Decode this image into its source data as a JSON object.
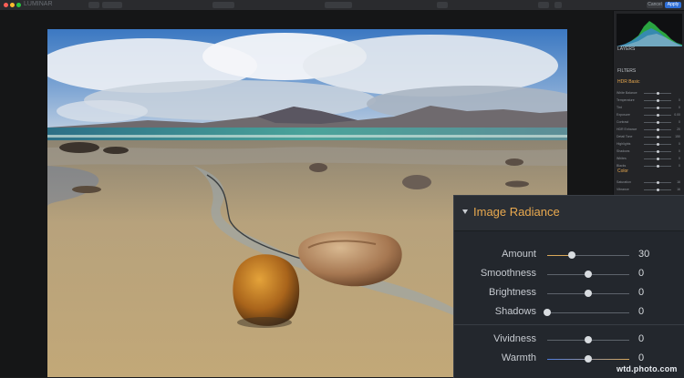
{
  "app": {
    "name": "LUMINAR",
    "cancel_label": "Cancel",
    "apply_label": "Apply"
  },
  "sidebar": {
    "layers_label": "LAYERS",
    "filters_label": "FILTERS",
    "section_hdr_label": "HDR Basic",
    "section_color_label": "Color",
    "hdr_rows": [
      {
        "label": "White Balance",
        "value": ""
      },
      {
        "label": "Temperature",
        "value": "0"
      },
      {
        "label": "Tint",
        "value": "0"
      },
      {
        "label": "Exposure",
        "value": "0.00"
      },
      {
        "label": "Contrast",
        "value": "0"
      },
      {
        "label": "HDR Enhance",
        "value": "20"
      },
      {
        "label": "Detail Tone",
        "value": "150"
      },
      {
        "label": "Highlights",
        "value": "0"
      },
      {
        "label": "Shadows",
        "value": "0"
      },
      {
        "label": "Whites",
        "value": "0"
      },
      {
        "label": "Blacks",
        "value": "0"
      }
    ],
    "color_rows": [
      {
        "label": "Saturation",
        "value": "16"
      },
      {
        "label": "Vibrance",
        "value": "16"
      }
    ]
  },
  "panel": {
    "title": "Image Radiance",
    "accent_color": "#e9a94f",
    "sliders": [
      {
        "label": "Amount",
        "value": "30",
        "level": 0.3,
        "fill": true
      },
      {
        "label": "Smoothness",
        "value": "0",
        "level": 0.5,
        "fill": false
      },
      {
        "label": "Brightness",
        "value": "0",
        "level": 0.5,
        "fill": false
      },
      {
        "label": "Shadows",
        "value": "0",
        "level": 0.0,
        "fill": false
      },
      {
        "label": "Vividness",
        "value": "0",
        "level": 0.5,
        "fill": false
      },
      {
        "label": "Warmth",
        "value": "0",
        "level": 0.5,
        "fill": false
      }
    ]
  },
  "watermark": "wtd.photo.com"
}
